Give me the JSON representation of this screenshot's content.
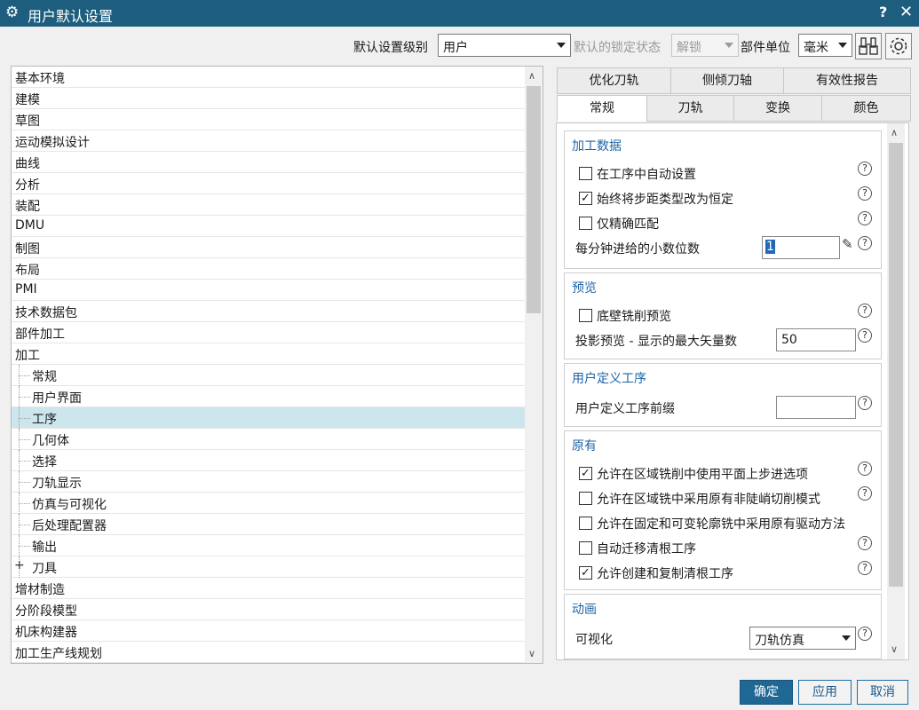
{
  "window": {
    "title": "用户默认设置",
    "help": "?",
    "close": "✕"
  },
  "toolbar": {
    "level_label": "默认设置级别",
    "level_value": "用户",
    "lock_label": "默认的锁定状态",
    "lock_value": "解锁",
    "unit_label": "部件单位",
    "unit_value": "毫米"
  },
  "tree": {
    "items": [
      "基本环境",
      "建模",
      "草图",
      "运动模拟设计",
      "曲线",
      "分析",
      "装配",
      "DMU",
      "制图",
      "布局",
      "PMI",
      "技术数据包",
      "部件加工",
      "加工"
    ],
    "children": [
      "常规",
      "用户界面",
      "工序",
      "几何体",
      "选择",
      "刀轨显示",
      "仿真与可视化",
      "后处理配置器",
      "输出",
      "刀具"
    ],
    "selected_child": "工序",
    "tail_items": [
      "增材制造",
      "分阶段模型",
      "机床构建器",
      "加工生产线规划"
    ]
  },
  "tabs": {
    "row1": [
      "优化刀轨",
      "侧倾刀轴",
      "有效性报告"
    ],
    "row2": [
      "常规",
      "刀轨",
      "变换",
      "颜色"
    ],
    "active": "常规"
  },
  "groups": {
    "machining_data": {
      "title": "加工数据",
      "auto_set": {
        "label": "在工序中自动设置",
        "checked": false
      },
      "constant_step": {
        "label": "始终将步距类型改为恒定",
        "checked": true
      },
      "exact_match": {
        "label": "仅精确匹配",
        "checked": false
      },
      "feed_decimals": {
        "label": "每分钟进给的小数位数",
        "value": "1"
      }
    },
    "preview": {
      "title": "预览",
      "floor_wall": {
        "label": "底壁铣削预览",
        "checked": false
      },
      "max_vectors": {
        "label": "投影预览 - 显示的最大矢量数",
        "value": "50"
      }
    },
    "user_defined": {
      "title": "用户定义工序",
      "prefix": {
        "label": "用户定义工序前缀",
        "value": ""
      }
    },
    "legacy": {
      "title": "原有",
      "items": [
        {
          "label": "允许在区域铣削中使用平面上步进选项",
          "checked": true
        },
        {
          "label": "允许在区域铣中采用原有非陡峭切削模式",
          "checked": false
        },
        {
          "label": "允许在固定和可变轮廓铣中采用原有驱动方法",
          "checked": false
        },
        {
          "label": "自动迁移清根工序",
          "checked": false
        },
        {
          "label": "允许创建和复制清根工序",
          "checked": true
        }
      ]
    },
    "animation": {
      "title": "动画",
      "visualize": {
        "label": "可视化",
        "value": "刀轨仿真"
      }
    }
  },
  "buttons": {
    "ok": "确定",
    "apply": "应用",
    "cancel": "取消"
  },
  "colors": {
    "titlebar": "#1d5e7e",
    "accent": "#1d64a6",
    "selected_row": "#cde5ec"
  }
}
